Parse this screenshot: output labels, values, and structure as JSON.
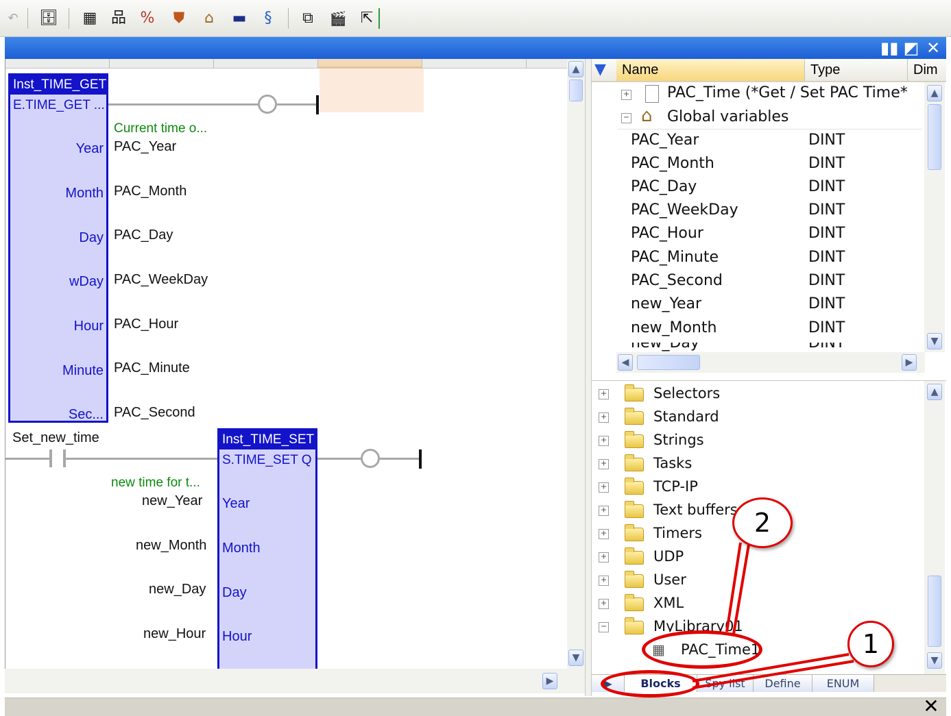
{
  "toolbar": {
    "icons": [
      "undo-icon",
      "insert-variable-icon",
      "grid-icon",
      "hierarchy-icon",
      "variables-toggle-icon",
      "shield-icon",
      "home-icon",
      "flag-icon",
      "symbol-icon",
      "window-icon",
      "clapper-icon",
      "arrow-icon"
    ],
    "glyphs": [
      "↶",
      "🗄",
      "▦",
      "品",
      "%",
      "⛊",
      "⌂",
      "▬",
      "§",
      "⧉",
      "🎬",
      "⇱"
    ]
  },
  "titlebar": {
    "buttons": [
      "▮▮",
      "◩",
      "✕"
    ]
  },
  "diagram": {
    "block1": {
      "title": "Inst_TIME_GET",
      "type": "E.TIME_GET ...",
      "comment": "Current time o...",
      "outputs": [
        {
          "pin": "Year",
          "var": "PAC_Year"
        },
        {
          "pin": "Month",
          "var": "PAC_Month"
        },
        {
          "pin": "Day",
          "var": "PAC_Day"
        },
        {
          "pin": "wDay",
          "var": "PAC_WeekDay"
        },
        {
          "pin": "Hour",
          "var": "PAC_Hour"
        },
        {
          "pin": "Minute",
          "var": "PAC_Minute"
        },
        {
          "pin": "Sec...",
          "var": "PAC_Second"
        }
      ]
    },
    "contact_label": "Set_new_time",
    "block2": {
      "title": "Inst_TIME_SET",
      "type": "S.TIME_SET Q",
      "comment": "new time for t...",
      "inputs": [
        {
          "var": "new_Year",
          "pin": "Year"
        },
        {
          "var": "new_Month",
          "pin": "Month"
        },
        {
          "var": "new_Day",
          "pin": "Day"
        },
        {
          "var": "new_Hour",
          "pin": "Hour"
        }
      ]
    }
  },
  "variables": {
    "columns": [
      "Name",
      "Type",
      "Dim"
    ],
    "group_pac_time": "PAC_Time (*Get / Set PAC Time*",
    "group_global": "Global variables",
    "rows": [
      {
        "name": "PAC_Year",
        "type": "DINT"
      },
      {
        "name": "PAC_Month",
        "type": "DINT"
      },
      {
        "name": "PAC_Day",
        "type": "DINT"
      },
      {
        "name": "PAC_WeekDay",
        "type": "DINT"
      },
      {
        "name": "PAC_Hour",
        "type": "DINT"
      },
      {
        "name": "PAC_Minute",
        "type": "DINT"
      },
      {
        "name": "PAC_Second",
        "type": "DINT"
      },
      {
        "name": "new_Year",
        "type": "DINT"
      },
      {
        "name": "new_Month",
        "type": "DINT"
      },
      {
        "name": "new_Day",
        "type": "DINT"
      }
    ]
  },
  "library": {
    "folders": [
      "Selectors",
      "Standard",
      "Strings",
      "Tasks",
      "TCP-IP",
      "Text buffers",
      "Timers",
      "UDP",
      "User",
      "XML",
      "MyLibrary01"
    ],
    "child": "PAC_Time1"
  },
  "tabs": [
    "Blocks",
    "Spy list",
    "Define",
    "ENUM"
  ],
  "annotations": {
    "callout1": "1",
    "callout2": "2"
  },
  "colors": {
    "block_border": "#1313c9",
    "block_fill": "#d4d4fb",
    "titlebar": "#1d5fd6",
    "annotation": "#e00000",
    "comment": "#0e8a0e"
  }
}
